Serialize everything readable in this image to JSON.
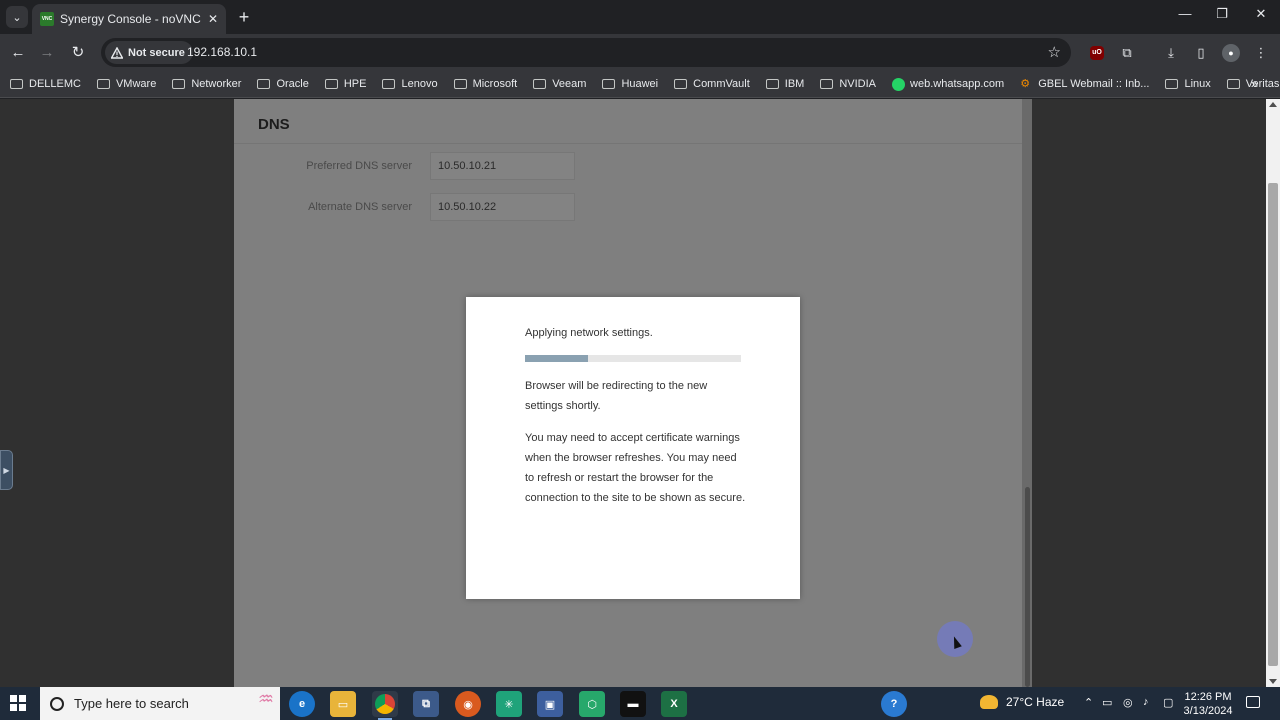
{
  "browser": {
    "tab_title": "Synergy Console - noVNC",
    "tab_favicon_text": "VNC",
    "security_label": "Not secure",
    "url": "192.168.10.1",
    "ublock_label": "uO",
    "bookmarks": [
      {
        "label": "DELLEMC",
        "icon": "folder-icon"
      },
      {
        "label": "VMware",
        "icon": "folder-icon"
      },
      {
        "label": "Networker",
        "icon": "folder-icon"
      },
      {
        "label": "Oracle",
        "icon": "folder-icon"
      },
      {
        "label": "HPE",
        "icon": "folder-icon"
      },
      {
        "label": "Lenovo",
        "icon": "folder-icon"
      },
      {
        "label": "Microsoft",
        "icon": "folder-icon"
      },
      {
        "label": "Veeam",
        "icon": "folder-icon"
      },
      {
        "label": "Huawei",
        "icon": "folder-icon"
      },
      {
        "label": "CommVault",
        "icon": "folder-icon"
      },
      {
        "label": "IBM",
        "icon": "folder-icon"
      },
      {
        "label": "NVIDIA",
        "icon": "folder-icon"
      },
      {
        "label": "web.whatsapp.com",
        "icon": "whatsapp-icon"
      },
      {
        "label": "GBEL Webmail :: Inb...",
        "icon": "webmail-icon"
      },
      {
        "label": "Linux",
        "icon": "folder-icon"
      },
      {
        "label": "Veritas",
        "icon": "folder-icon"
      }
    ]
  },
  "dns": {
    "heading": "DNS",
    "preferred_label": "Preferred DNS server",
    "preferred_value": "10.50.10.21",
    "alternate_label": "Alternate DNS server",
    "alternate_value": "10.50.10.22"
  },
  "modal": {
    "title": "Applying network settings.",
    "progress_fraction": 0.29,
    "paragraph1": "Browser will be redirecting to the new settings shortly.",
    "paragraph2": "You may need to accept certificate warnings when the browser refreshes. You may need to refresh or restart the browser for the connection to the site to be shown as secure."
  },
  "taskbar": {
    "search_placeholder": "Type here to search",
    "weather": "27°C  Haze",
    "time": "12:26 PM",
    "date": "3/13/2024"
  },
  "colors": {
    "progress_fill": "#8aa1b1",
    "browser_frame": "#35363a",
    "taskbar": "#1f2b3a"
  }
}
